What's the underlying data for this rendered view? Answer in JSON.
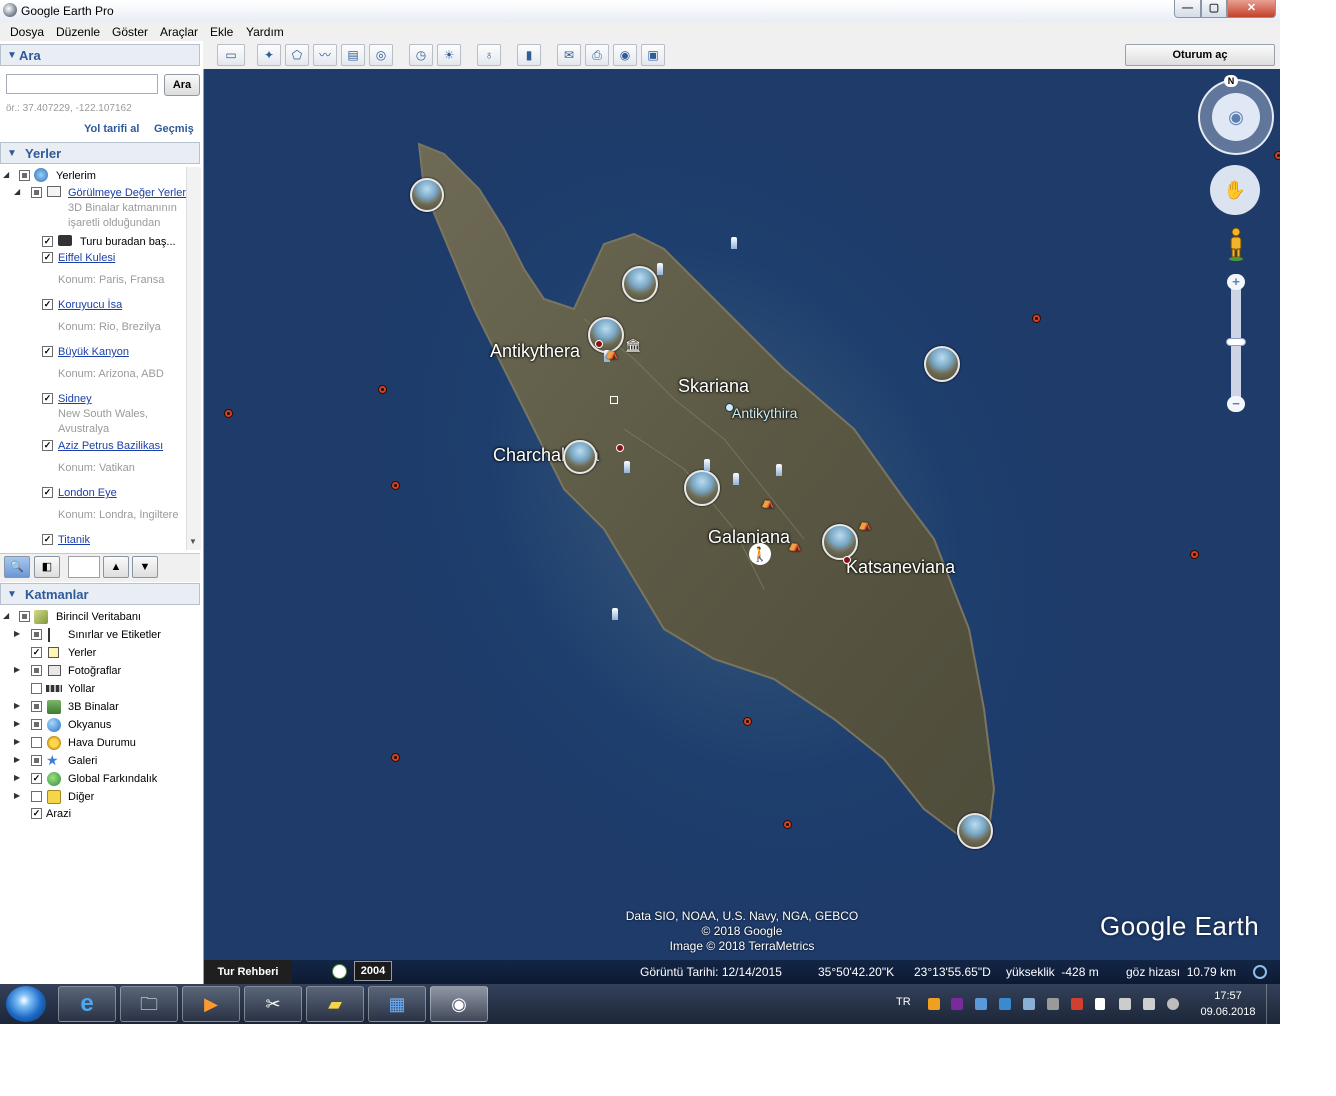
{
  "window": {
    "title": "Google Earth Pro",
    "min": "—",
    "max": "▢",
    "close": "✕"
  },
  "menu": [
    "Dosya",
    "Düzenle",
    "Göster",
    "Araçlar",
    "Ekle",
    "Yardım"
  ],
  "search": {
    "header": "Ara",
    "input_value": "",
    "button": "Ara",
    "hint": "ör.: 37.407229, -122.107162",
    "directions": "Yol tarifi al",
    "history": "Geçmiş"
  },
  "places": {
    "header": "Yerler",
    "root": "Yerlerim",
    "folder": "Görülmeye Değer Yerler",
    "folder_note_1": "3D Binalar katmanının",
    "folder_note_2": "işaretli olduğundan",
    "tour": "Turu buradan baş...",
    "items": [
      {
        "name": "Eiffel Kulesi",
        "sub": "Konum: Paris, Fransa"
      },
      {
        "name": "Koruyucu İsa",
        "sub": "Konum: Rio, Brezilya"
      },
      {
        "name": "Büyük Kanyon",
        "sub": "Konum: Arizona, ABD"
      },
      {
        "name": "Sidney",
        "sub": "New South Wales,",
        "sub2": "Avustralya"
      },
      {
        "name": "Aziz Petrus Bazilikası",
        "sub": "Konum: Vatikan"
      },
      {
        "name": "London Eye",
        "sub": "Konum: Londra, İngiltere"
      },
      {
        "name": "Titanik"
      }
    ]
  },
  "layers": {
    "header": "Katmanlar",
    "root": "Birincil Veritabanı",
    "items": [
      "Sınırlar ve Etiketler",
      "Yerler",
      "Fotoğraflar",
      "Yollar",
      "3B Binalar",
      "Okyanus",
      "Hava Durumu",
      "Galeri",
      "Global Farkındalık",
      "Diğer"
    ],
    "terrain": "Arazi"
  },
  "toolbar": {
    "signin": "Oturum aç"
  },
  "map": {
    "labels": {
      "antikythera": "Antikythera",
      "skariana": "Skariana",
      "antikythira": "Antikythira",
      "charchaliana": "Charchaliana",
      "galaniana": "Galaniana",
      "katsaneviana": "Katsaneviana"
    },
    "attribution_1": "Data SIO, NOAA, U.S. Navy, NGA, GEBCO",
    "attribution_2": "© 2018 Google",
    "attribution_3": "Image © 2018 TerraMetrics",
    "logo": "Google Earth",
    "compass_n": "N",
    "zoom_in": "+",
    "zoom_out": "−"
  },
  "status": {
    "tour_guide": "Tur Rehberi",
    "year": "2004",
    "imagery_date": "Görüntü Tarihi: 12/14/2015",
    "lat": "35°50'42.20\"K",
    "lon": "23°13'55.65\"D",
    "elevation": "yükseklik  -428 m",
    "eye_alt": "göz hizası  10.79 km"
  },
  "taskbar": {
    "lang": "TR",
    "time": "17:57",
    "date": "09.06.2018"
  },
  "colors": {
    "accent": "#2e5a9a",
    "link": "#1a3fa8",
    "sea": "#1e3b6a",
    "land": "#5a5a45"
  }
}
